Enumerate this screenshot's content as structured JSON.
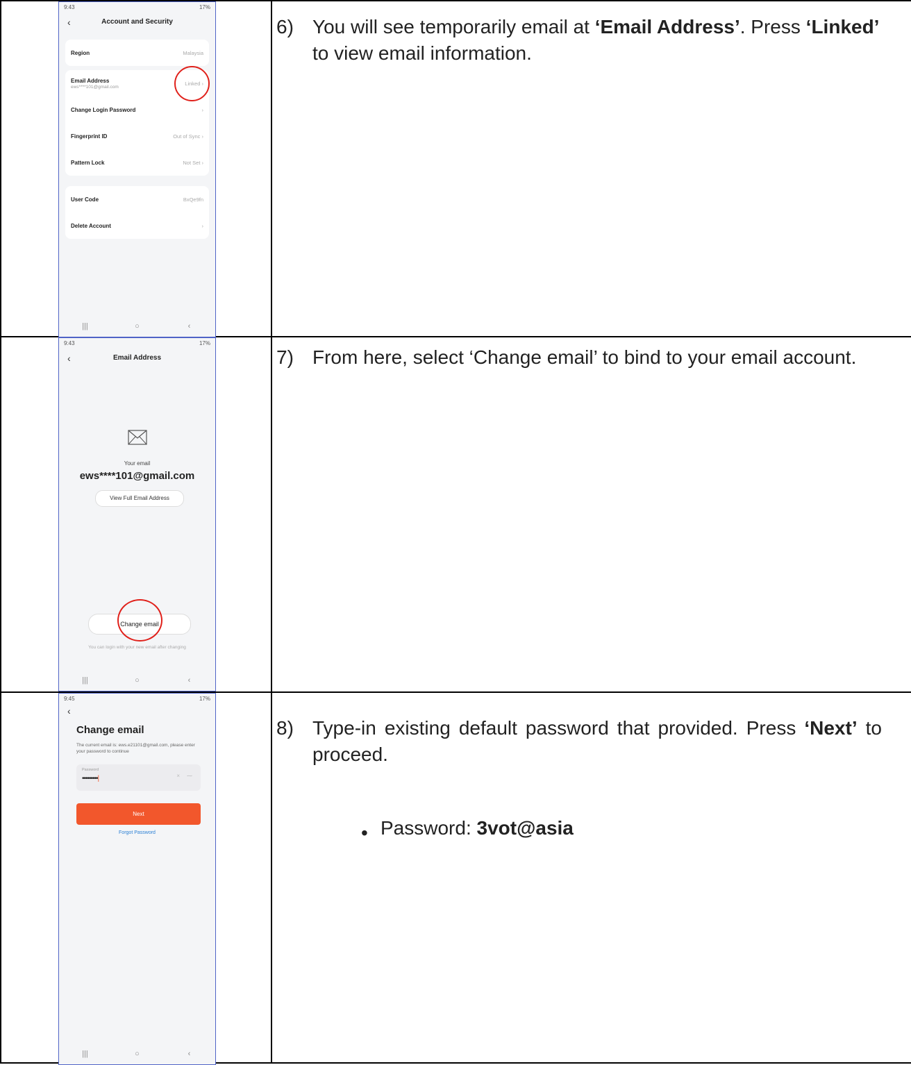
{
  "steps": [
    {
      "number": "6)",
      "text_parts": [
        "You will see temporarily email at ",
        "‘Email Address’",
        ". Press ",
        "‘Linked’",
        " to view email information."
      ],
      "phone": {
        "status_time": "9:43",
        "status_right": "17%",
        "title": "Account and Security",
        "rows": [
          {
            "label": "Region",
            "value": "Malaysia"
          },
          {
            "label": "Email Address",
            "sub": "ews****101@gmail.com",
            "value": "Linked"
          },
          {
            "label": "Change Login Password",
            "value": ""
          },
          {
            "label": "Fingerprint ID",
            "value": "Out of Sync"
          },
          {
            "label": "Pattern Lock",
            "value": "Not Set"
          },
          {
            "label": "User Code",
            "value": "BxQe9fn"
          },
          {
            "label": "Delete Account",
            "value": ""
          }
        ]
      }
    },
    {
      "number": "7)",
      "text": "From here, select ‘Change email’ to bind to your email account.",
      "phone": {
        "status_time": "9:43",
        "status_right": "17%",
        "title": "Email Address",
        "your_email_label": "Your email",
        "email": "ews****101@gmail.com",
        "view_button": "View Full Email Address",
        "change_button": "Change email",
        "footnote": "You can login with your new email after changing"
      }
    },
    {
      "number": "8)",
      "text_parts": [
        "Type-in existing default password that provided. Press ",
        "‘Next’",
        " to proceed."
      ],
      "bullet_label": "Password: ",
      "bullet_value": "3vot@asia",
      "phone": {
        "status_time": "9:45",
        "status_right": "17%",
        "heading": "Change email",
        "desc": "The current email is: ews.e21101@gmail.com, please enter your password to continue",
        "field_label": "Password",
        "field_value": "•••••••••",
        "next_button": "Next",
        "forgot_link": "Forgot Password"
      }
    }
  ],
  "nav": {
    "recent": "|||",
    "home": "○",
    "back": "‹"
  },
  "colors": {
    "accent": "#f2572c",
    "link": "#2a7fd4",
    "circle": "#e0201a"
  }
}
